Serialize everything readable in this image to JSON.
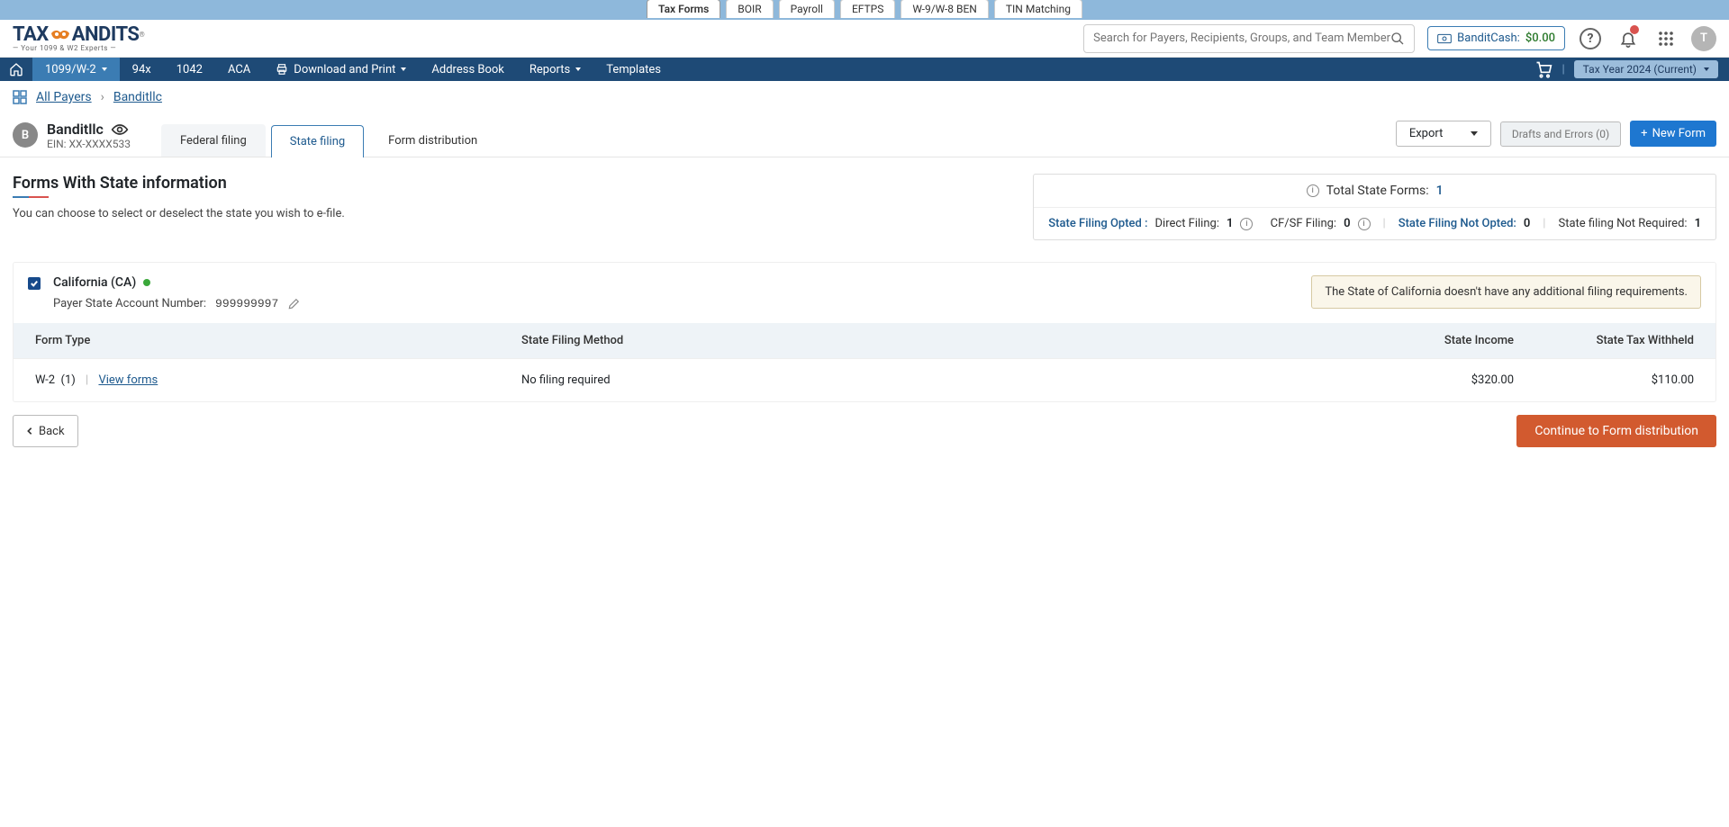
{
  "topTabs": [
    {
      "label": "Tax Forms",
      "active": true
    },
    {
      "label": "BOIR",
      "active": false
    },
    {
      "label": "Payroll",
      "active": false
    },
    {
      "label": "EFTPS",
      "active": false
    },
    {
      "label": "W-9/W-8 BEN",
      "active": false
    },
    {
      "label": "TIN Matching",
      "active": false
    }
  ],
  "logo": {
    "prefix": "TAX",
    "suffix": "ANDITS",
    "tagline": "— Your 1099 & W2 Experts —"
  },
  "search": {
    "placeholder": "Search for Payers, Recipients, Groups, and Team Members"
  },
  "banditcash": {
    "label": "BanditCash:",
    "amount": "$0.00"
  },
  "avatarLetter": "T",
  "nav": {
    "items": [
      {
        "label": "1099/W-2",
        "active": true,
        "caret": true
      },
      {
        "label": "94x"
      },
      {
        "label": "1042"
      },
      {
        "label": "ACA"
      },
      {
        "label": "Download and Print",
        "printIcon": true,
        "caret": true
      },
      {
        "label": "Address Book"
      },
      {
        "label": "Reports",
        "caret": true
      },
      {
        "label": "Templates"
      }
    ],
    "taxYear": "Tax Year 2024 (Current)"
  },
  "breadcrumb": {
    "allPayers": "All Payers",
    "payer": "Banditllc"
  },
  "payer": {
    "avatar": "B",
    "name": "Banditllc",
    "ein": "EIN: XX-XXXX533",
    "tabs": [
      {
        "label": "Federal filing"
      },
      {
        "label": "State filing",
        "active": true
      },
      {
        "label": "Form distribution"
      }
    ],
    "exportLabel": "Export",
    "draftsLabel": "Drafts and Errors (0)",
    "newFormLabel": "New  Form"
  },
  "page": {
    "title": "Forms With State information",
    "subtitle": "You can choose to select or deselect the state you wish to e-file."
  },
  "summary": {
    "totalLabel": "Total State Forms:",
    "totalCount": "1",
    "optedLabel": "State Filing Opted :",
    "directLabel": "Direct Filing:",
    "directCount": "1",
    "cfsfLabel": "CF/SF Filing:",
    "cfsfCount": "0",
    "notOptedLabel": "State Filing Not Opted:",
    "notOptedCount": "0",
    "notRequiredLabel": "State filing Not Required:",
    "notRequiredCount": "1"
  },
  "state": {
    "name": "California (CA)",
    "acctLabel": "Payer State Account Number:",
    "acctNumber": "999999997",
    "note": "The State of California doesn't have any additional filing requirements.",
    "columns": {
      "type": "Form Type",
      "method": "State Filing Method",
      "income": "State Income",
      "withheld": "State Tax Withheld"
    },
    "row": {
      "form": "W-2",
      "count": "(1)",
      "viewLink": "View forms",
      "method": "No filing required",
      "income": "$320.00",
      "withheld": "$110.00"
    }
  },
  "footer": {
    "back": "Back",
    "continue": "Continue to Form distribution"
  }
}
